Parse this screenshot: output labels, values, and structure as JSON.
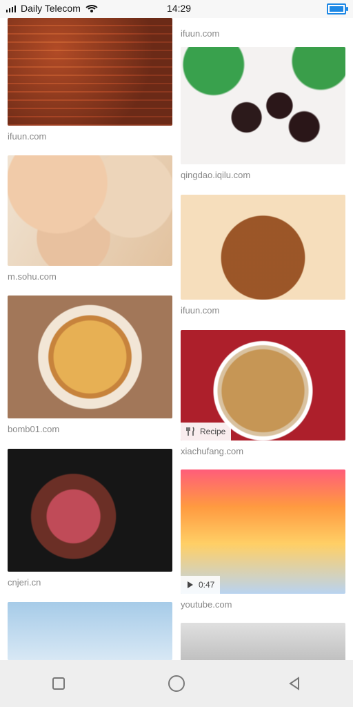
{
  "status_bar": {
    "carrier": "Daily Telecom",
    "time": "14:29",
    "icons": {
      "signal": "signal-icon",
      "wifi": "wifi-icon",
      "battery": "battery-icon"
    },
    "colors": {
      "battery": "#1e88e5"
    }
  },
  "left_column": [
    {
      "source": "ifuun.com",
      "image": "ribs"
    },
    {
      "source": "m.sohu.com",
      "image": "noodle"
    },
    {
      "source": "bomb01.com",
      "image": "pie"
    },
    {
      "source": "cnjeri.cn",
      "image": "steak"
    },
    {
      "source": "",
      "image": "fish"
    }
  ],
  "right_column": [
    {
      "source": "ifuun.com",
      "image": "sausage-slices"
    },
    {
      "source": "qingdao.iqilu.com",
      "image": "hotdog"
    },
    {
      "source": "ifuun.com",
      "image": "pot",
      "badge": {
        "label": "Recipe",
        "icon": "fork-knife-icon"
      }
    },
    {
      "source": "xiachufang.com",
      "image": "tv",
      "video": {
        "duration": "0:47",
        "icon": "play-icon"
      }
    },
    {
      "source": "youtube.com",
      "image": "cook"
    }
  ],
  "navigation": {
    "items": [
      {
        "name": "recent-apps",
        "icon": "square-icon"
      },
      {
        "name": "home",
        "icon": "circle-icon"
      },
      {
        "name": "back",
        "icon": "back-triangle-icon"
      }
    ]
  }
}
